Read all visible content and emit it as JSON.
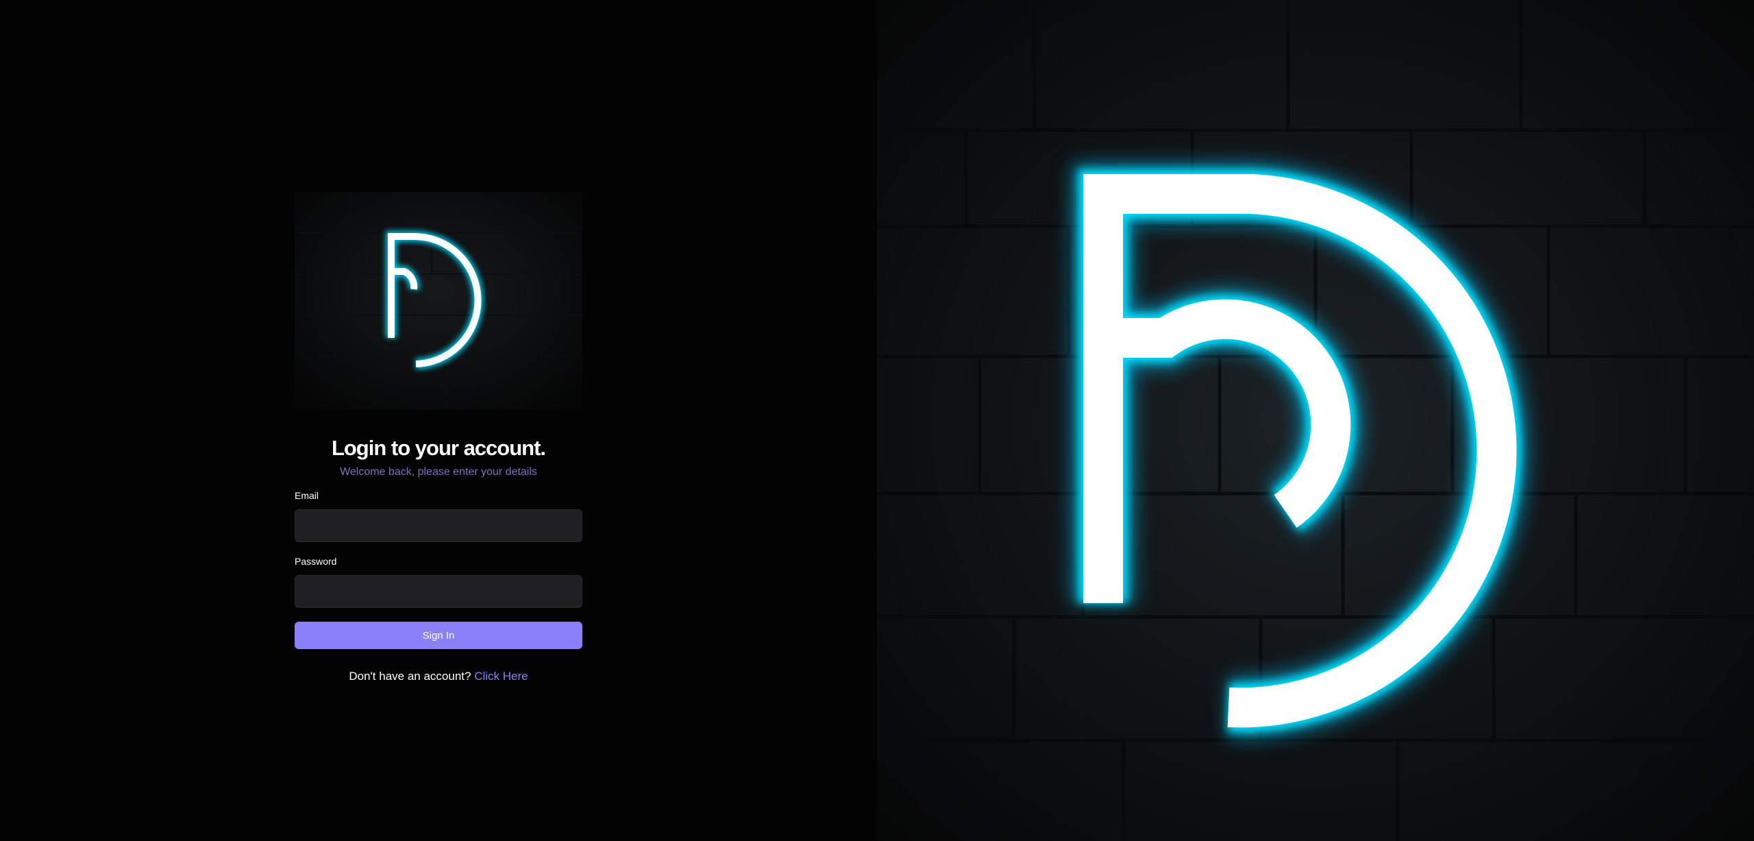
{
  "login": {
    "title": "Login to your account.",
    "subtitle": "Welcome back, please enter your details",
    "email_label": "Email",
    "email_value": "",
    "password_label": "Password",
    "password_value": "",
    "signin_label": "Sign In",
    "signup_prompt": "Don't have an account?",
    "signup_link": "Click Here"
  },
  "brand": {
    "logo_icon": "neon-d-logo-icon",
    "glow_color": "#00d9ff",
    "accent_color": "#8a80f7",
    "subtitle_color": "#7b74b8",
    "input_bg": "#202022"
  }
}
